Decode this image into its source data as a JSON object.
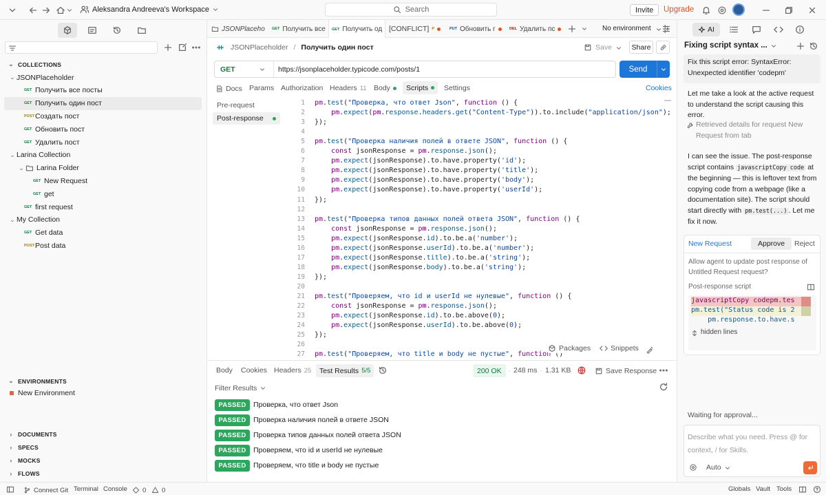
{
  "topbar": {
    "workspace": "Aleksandra Andreeva's Workspace",
    "search_placeholder": "Search",
    "invite": "Invite",
    "upgrade": "Upgrade"
  },
  "sidebar": {
    "collections_title": "COLLECTIONS",
    "tree": [
      {
        "label": "JSONPlaceholder",
        "kind": "collection",
        "depth": 0
      },
      {
        "label": "Получить все посты",
        "method": "GET",
        "depth": 1
      },
      {
        "label": "Получить один пост",
        "method": "GET",
        "depth": 1,
        "selected": true
      },
      {
        "label": "Создать пост",
        "method": "POST",
        "depth": 1
      },
      {
        "label": "Обновить пост",
        "method": "GET",
        "depth": 1
      },
      {
        "label": "Удалить пост",
        "method": "GET",
        "depth": 1
      },
      {
        "label": "Larina Collection",
        "kind": "collection",
        "depth": 0
      },
      {
        "label": "Larina Folder",
        "kind": "folder",
        "depth": 1
      },
      {
        "label": "New Request",
        "method": "GET",
        "depth": 2
      },
      {
        "label": "get",
        "method": "GET",
        "depth": 2
      },
      {
        "label": "first request",
        "method": "GET",
        "depth": 1
      },
      {
        "label": "My Collection",
        "kind": "collection",
        "depth": 0
      },
      {
        "label": "Get data",
        "method": "GET",
        "depth": 1
      },
      {
        "label": "Post data",
        "method": "POST",
        "depth": 1
      }
    ],
    "environments_title": "ENVIRONMENTS",
    "environment": "New Environment",
    "sections": [
      "DOCUMENTS",
      "SPECS",
      "MOCKS",
      "FLOWS"
    ]
  },
  "tabs": [
    {
      "label": "JSONPlaceho",
      "italic": true
    },
    {
      "method": "GET",
      "label": "Получить все"
    },
    {
      "method": "GET",
      "label": "Получить од",
      "active": true
    },
    {
      "label": "[CONFLICT]",
      "method": "P",
      "dot": true
    },
    {
      "method": "PUT",
      "label": "Обновить г",
      "dot": true
    },
    {
      "method": "DEL",
      "label": "Удалить пс",
      "dot": true
    }
  ],
  "env_selector": "No environment",
  "request": {
    "breadcrumb_collection": "JSONPlaceholder",
    "breadcrumb_name": "Получить один пост",
    "save": "Save",
    "share": "Share",
    "method": "GET",
    "url": "https://jsonplaceholder.typicode.com/posts/1",
    "send": "Send",
    "subtabs": {
      "docs": "Docs",
      "params": "Params",
      "authorization": "Authorization",
      "headers": "Headers",
      "headers_count": "11",
      "body": "Body",
      "scripts": "Scripts",
      "settings": "Settings",
      "cookies": "Cookies"
    },
    "script_tabs": [
      "Pre-request",
      "Post-response"
    ],
    "packages": "Packages",
    "snippets": "Snippets"
  },
  "code": [
    [
      [
        "kw",
        "pm"
      ],
      [
        "t",
        "."
      ],
      [
        "fn",
        "test"
      ],
      [
        "t",
        "("
      ],
      [
        "str",
        "\"Проверка, что ответ Json\""
      ],
      [
        "t",
        ", "
      ],
      [
        "kw",
        "function"
      ],
      [
        "t",
        " () {"
      ]
    ],
    [
      [
        "t",
        "    "
      ],
      [
        "kw",
        "pm"
      ],
      [
        "t",
        "."
      ],
      [
        "fn",
        "expect"
      ],
      [
        "t",
        "("
      ],
      [
        "kw",
        "pm"
      ],
      [
        "t",
        "."
      ],
      [
        "prop",
        "response"
      ],
      [
        "t",
        "."
      ],
      [
        "prop",
        "headers"
      ],
      [
        "t",
        "."
      ],
      [
        "fn",
        "get"
      ],
      [
        "t",
        "("
      ],
      [
        "str",
        "\"Content-Type\""
      ],
      [
        "t",
        ")).to.include("
      ],
      [
        "str",
        "\"application/json\""
      ],
      [
        "t",
        ");"
      ]
    ],
    [
      [
        "t",
        "});"
      ]
    ],
    [
      [
        "t",
        ""
      ]
    ],
    [
      [
        "kw",
        "pm"
      ],
      [
        "t",
        "."
      ],
      [
        "fn",
        "test"
      ],
      [
        "t",
        "("
      ],
      [
        "str",
        "\"Проверка наличия полей в ответе JSON\""
      ],
      [
        "t",
        ", "
      ],
      [
        "kw",
        "function"
      ],
      [
        "t",
        " () {"
      ]
    ],
    [
      [
        "t",
        "    "
      ],
      [
        "kw",
        "const"
      ],
      [
        "t",
        " jsonResponse = "
      ],
      [
        "kw",
        "pm"
      ],
      [
        "t",
        "."
      ],
      [
        "prop",
        "response"
      ],
      [
        "t",
        "."
      ],
      [
        "fn",
        "json"
      ],
      [
        "t",
        "();"
      ]
    ],
    [
      [
        "t",
        "    "
      ],
      [
        "kw",
        "pm"
      ],
      [
        "t",
        "."
      ],
      [
        "fn",
        "expect"
      ],
      [
        "t",
        "(jsonResponse).to.have.property("
      ],
      [
        "str",
        "'id'"
      ],
      [
        "t",
        ");"
      ]
    ],
    [
      [
        "t",
        "    "
      ],
      [
        "kw",
        "pm"
      ],
      [
        "t",
        "."
      ],
      [
        "fn",
        "expect"
      ],
      [
        "t",
        "(jsonResponse).to.have.property("
      ],
      [
        "str",
        "'title'"
      ],
      [
        "t",
        ");"
      ]
    ],
    [
      [
        "t",
        "    "
      ],
      [
        "kw",
        "pm"
      ],
      [
        "t",
        "."
      ],
      [
        "fn",
        "expect"
      ],
      [
        "t",
        "(jsonResponse).to.have.property("
      ],
      [
        "str",
        "'body'"
      ],
      [
        "t",
        ");"
      ]
    ],
    [
      [
        "t",
        "    "
      ],
      [
        "kw",
        "pm"
      ],
      [
        "t",
        "."
      ],
      [
        "fn",
        "expect"
      ],
      [
        "t",
        "(jsonResponse).to.have.property("
      ],
      [
        "str",
        "'userId'"
      ],
      [
        "t",
        ");"
      ]
    ],
    [
      [
        "t",
        "});"
      ]
    ],
    [
      [
        "t",
        ""
      ]
    ],
    [
      [
        "kw",
        "pm"
      ],
      [
        "t",
        "."
      ],
      [
        "fn",
        "test"
      ],
      [
        "t",
        "("
      ],
      [
        "str",
        "\"Проверка типов данных полей ответа JSON\""
      ],
      [
        "t",
        ", "
      ],
      [
        "kw",
        "function"
      ],
      [
        "t",
        " () {"
      ]
    ],
    [
      [
        "t",
        "    "
      ],
      [
        "kw",
        "const"
      ],
      [
        "t",
        " jsonResponse = "
      ],
      [
        "kw",
        "pm"
      ],
      [
        "t",
        "."
      ],
      [
        "prop",
        "response"
      ],
      [
        "t",
        "."
      ],
      [
        "fn",
        "json"
      ],
      [
        "t",
        "();"
      ]
    ],
    [
      [
        "t",
        "    "
      ],
      [
        "kw",
        "pm"
      ],
      [
        "t",
        "."
      ],
      [
        "fn",
        "expect"
      ],
      [
        "t",
        "(jsonResponse."
      ],
      [
        "prop",
        "id"
      ],
      [
        "t",
        ").to.be.a("
      ],
      [
        "str",
        "'number'"
      ],
      [
        "t",
        ");"
      ]
    ],
    [
      [
        "t",
        "    "
      ],
      [
        "kw",
        "pm"
      ],
      [
        "t",
        "."
      ],
      [
        "fn",
        "expect"
      ],
      [
        "t",
        "(jsonResponse."
      ],
      [
        "prop",
        "userId"
      ],
      [
        "t",
        ").to.be.a("
      ],
      [
        "str",
        "'number'"
      ],
      [
        "t",
        ");"
      ]
    ],
    [
      [
        "t",
        "    "
      ],
      [
        "kw",
        "pm"
      ],
      [
        "t",
        "."
      ],
      [
        "fn",
        "expect"
      ],
      [
        "t",
        "(jsonResponse."
      ],
      [
        "prop",
        "title"
      ],
      [
        "t",
        ").to.be.a("
      ],
      [
        "str",
        "'string'"
      ],
      [
        "t",
        ");"
      ]
    ],
    [
      [
        "t",
        "    "
      ],
      [
        "kw",
        "pm"
      ],
      [
        "t",
        "."
      ],
      [
        "fn",
        "expect"
      ],
      [
        "t",
        "(jsonResponse."
      ],
      [
        "prop",
        "body"
      ],
      [
        "t",
        ").to.be.a("
      ],
      [
        "str",
        "'string'"
      ],
      [
        "t",
        ");"
      ]
    ],
    [
      [
        "t",
        "});"
      ]
    ],
    [
      [
        "t",
        ""
      ]
    ],
    [
      [
        "kw",
        "pm"
      ],
      [
        "t",
        "."
      ],
      [
        "fn",
        "test"
      ],
      [
        "t",
        "("
      ],
      [
        "str",
        "\"Проверяем, что id и userId не нулевые\""
      ],
      [
        "t",
        ", "
      ],
      [
        "kw",
        "function"
      ],
      [
        "t",
        " () {"
      ]
    ],
    [
      [
        "t",
        "    "
      ],
      [
        "kw",
        "const"
      ],
      [
        "t",
        " jsonResponse = "
      ],
      [
        "kw",
        "pm"
      ],
      [
        "t",
        "."
      ],
      [
        "prop",
        "response"
      ],
      [
        "t",
        "."
      ],
      [
        "fn",
        "json"
      ],
      [
        "t",
        "();"
      ]
    ],
    [
      [
        "t",
        "    "
      ],
      [
        "kw",
        "pm"
      ],
      [
        "t",
        "."
      ],
      [
        "fn",
        "expect"
      ],
      [
        "t",
        "(jsonResponse."
      ],
      [
        "prop",
        "id"
      ],
      [
        "t",
        ").to.be.above("
      ],
      [
        "str",
        "0"
      ],
      [
        "t",
        ");"
      ]
    ],
    [
      [
        "t",
        "    "
      ],
      [
        "kw",
        "pm"
      ],
      [
        "t",
        "."
      ],
      [
        "fn",
        "expect"
      ],
      [
        "t",
        "(jsonResponse."
      ],
      [
        "prop",
        "userId"
      ],
      [
        "t",
        ").to.be.above("
      ],
      [
        "str",
        "0"
      ],
      [
        "t",
        ");"
      ]
    ],
    [
      [
        "t",
        "});"
      ]
    ],
    [
      [
        "t",
        ""
      ]
    ],
    [
      [
        "kw",
        "pm"
      ],
      [
        "t",
        "."
      ],
      [
        "fn",
        "test"
      ],
      [
        "t",
        "("
      ],
      [
        "str",
        "\"Проверяем, что title и body не пустые\""
      ],
      [
        "t",
        ", "
      ],
      [
        "kw",
        "function"
      ],
      [
        "t",
        " ()"
      ]
    ]
  ],
  "response": {
    "tabs": {
      "body": "Body",
      "cookies": "Cookies",
      "headers": "Headers",
      "headers_count": "25",
      "test_results": "Test Results",
      "test_count": "5/5"
    },
    "status": "200 OK",
    "time": "248 ms",
    "size": "1.31 KB",
    "save_response": "Save Response",
    "filter": "Filter Results",
    "results": [
      {
        "status": "PASSED",
        "name": "Проверка, что ответ Json"
      },
      {
        "status": "PASSED",
        "name": "Проверка наличия полей в ответе JSON"
      },
      {
        "status": "PASSED",
        "name": "Проверка типов данных полей ответа JSON"
      },
      {
        "status": "PASSED",
        "name": "Проверяем, что id и userId не нулевые"
      },
      {
        "status": "PASSED",
        "name": "Проверяем, что title и body не пустые"
      }
    ]
  },
  "ai": {
    "tab": "AI",
    "title": "Fixing script syntax ...",
    "user_msg": "Fix this script error: SyntaxError: Unexpected identifier 'codepm'",
    "msg1": "Let me take a look at the active request to understand the script causing this error.",
    "retrieved": "Retrieved details for request New Request from tab",
    "msg2_a": "I can see the issue. The post-response script contains",
    "msg2_code1": "javascriptCopy code",
    "msg2_b": "at the beginning — this is leftover text from copying code from a webpage (like a documentation site). The script should start directly with",
    "msg2_code2": "pm.test(...)",
    "msg2_c": ". Let me fix it now.",
    "card_request": "New Request",
    "approve": "Approve",
    "reject": "Reject",
    "card_question": "Allow agent to update post response of Untitled Request request?",
    "diff_title": "Post-response script",
    "diff_removed": "javascriptCopy codepm.tes",
    "diff_added": "pm.test(\"Status code is 2",
    "diff_line3": "    pm.response.to.have.s",
    "hidden_lines": "hidden lines",
    "waiting": "Waiting for approval...",
    "input_placeholder": "Describe what you need. Press @ for context, / for Skills.",
    "mode": "Auto"
  },
  "statusbar": {
    "connect_git": "Connect Git",
    "terminal": "Terminal",
    "console": "Console",
    "errors": "0",
    "warnings": "0",
    "globals": "Globals",
    "vault": "Vault",
    "tools": "Tools"
  },
  "colors": {
    "accent": "#1d77d9",
    "brand": "#e05320",
    "passed": "#2ca55d",
    "get": "#0b7c3d",
    "post": "#ad7a03"
  }
}
